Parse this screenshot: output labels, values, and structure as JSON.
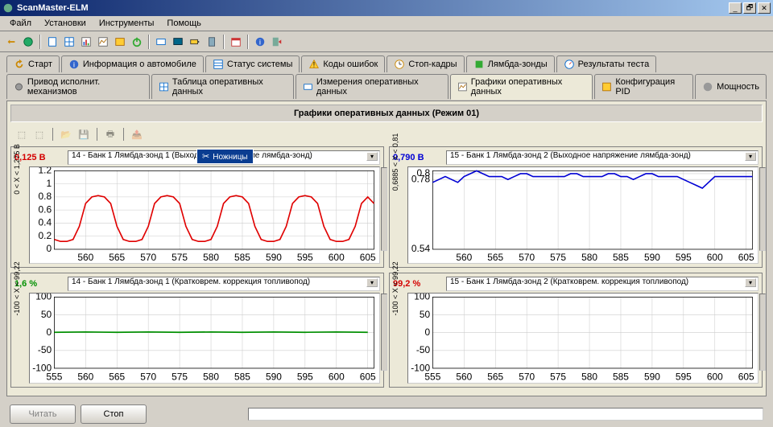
{
  "window": {
    "title": "ScanMaster-ELM"
  },
  "menu": [
    "Файл",
    "Установки",
    "Инструменты",
    "Помощь"
  ],
  "tabs1": [
    {
      "label": "Старт"
    },
    {
      "label": "Информация о автомобиле"
    },
    {
      "label": "Статус системы"
    },
    {
      "label": "Коды ошибок"
    },
    {
      "label": "Стоп-кадры"
    },
    {
      "label": "Лямбда-зонды"
    },
    {
      "label": "Результаты теста"
    }
  ],
  "tabs2": [
    {
      "label": "Привод исполнит. механизмов"
    },
    {
      "label": "Таблица оперативных данных"
    },
    {
      "label": "Измерения оперативных данных"
    },
    {
      "label": "Графики оперативных данных",
      "active": true
    },
    {
      "label": "Конфигурация PID"
    },
    {
      "label": "Мощность"
    }
  ],
  "section_title": "Графики оперативных данных (Режим 01)",
  "tooltip": {
    "text": "Ножницы"
  },
  "buttons": {
    "read": "Читать",
    "stop": "Стоп"
  },
  "chart_data": [
    {
      "id": "c1",
      "value": "0,125 В",
      "value_color": "#d40000",
      "selector": "14 - Банк 1 Лямбда-зонд 1 (Выходное напряжение лямбда-зонд)",
      "type": "line",
      "x": [
        555,
        556,
        557,
        558,
        559,
        560,
        561,
        562,
        563,
        564,
        565,
        566,
        567,
        568,
        569,
        570,
        571,
        572,
        573,
        574,
        575,
        576,
        577,
        578,
        579,
        580,
        581,
        582,
        583,
        584,
        585,
        586,
        587,
        588,
        589,
        590,
        591,
        592,
        593,
        594,
        595,
        596,
        597,
        598,
        599,
        600,
        601,
        602,
        603,
        604,
        605,
        606
      ],
      "y": [
        0.15,
        0.12,
        0.12,
        0.15,
        0.35,
        0.7,
        0.8,
        0.82,
        0.8,
        0.7,
        0.35,
        0.15,
        0.12,
        0.12,
        0.15,
        0.35,
        0.7,
        0.8,
        0.82,
        0.8,
        0.7,
        0.35,
        0.15,
        0.12,
        0.12,
        0.15,
        0.35,
        0.7,
        0.8,
        0.82,
        0.8,
        0.7,
        0.35,
        0.15,
        0.12,
        0.12,
        0.15,
        0.35,
        0.7,
        0.8,
        0.82,
        0.8,
        0.7,
        0.35,
        0.15,
        0.12,
        0.12,
        0.15,
        0.35,
        0.7,
        0.8,
        0.7
      ],
      "xlim": [
        555,
        606
      ],
      "ylim": [
        0,
        1.2
      ],
      "yticks": [
        0,
        0.2,
        0.4,
        0.6,
        0.8,
        1,
        1.2
      ],
      "xticks": [
        560,
        565,
        570,
        575,
        580,
        585,
        590,
        595,
        600,
        605
      ],
      "ylabel": "0 < X < 1,275 В",
      "line_color": "#e00000"
    },
    {
      "id": "c2",
      "value": "0,790 В",
      "value_color": "#0000d4",
      "selector": "15 - Банк 1 Лямбда-зонд 2 (Выходное напряжение лямбда-зонд)",
      "type": "line",
      "x": [
        555,
        556,
        557,
        558,
        559,
        560,
        561,
        562,
        563,
        564,
        565,
        566,
        567,
        568,
        569,
        570,
        571,
        572,
        573,
        574,
        575,
        576,
        577,
        578,
        579,
        580,
        581,
        582,
        583,
        584,
        585,
        586,
        587,
        588,
        589,
        590,
        591,
        592,
        593,
        594,
        595,
        596,
        597,
        598,
        599,
        600,
        601,
        602,
        603,
        604,
        605,
        606
      ],
      "y": [
        0.77,
        0.78,
        0.79,
        0.78,
        0.77,
        0.79,
        0.8,
        0.81,
        0.8,
        0.79,
        0.79,
        0.79,
        0.78,
        0.79,
        0.8,
        0.8,
        0.79,
        0.79,
        0.79,
        0.79,
        0.79,
        0.79,
        0.8,
        0.8,
        0.79,
        0.79,
        0.79,
        0.79,
        0.8,
        0.8,
        0.79,
        0.79,
        0.78,
        0.79,
        0.8,
        0.8,
        0.79,
        0.79,
        0.79,
        0.79,
        0.78,
        0.77,
        0.76,
        0.75,
        0.77,
        0.79,
        0.79,
        0.79,
        0.79,
        0.79,
        0.79,
        0.79
      ],
      "xlim": [
        555,
        606
      ],
      "ylim": [
        0.54,
        0.81
      ],
      "yticks": [
        0.54,
        0.78,
        0.8
      ],
      "xticks": [
        560,
        565,
        570,
        575,
        580,
        585,
        590,
        595,
        600,
        605
      ],
      "ylabel": "0,6885 < X < 0,81",
      "line_color": "#0000d4"
    },
    {
      "id": "c3",
      "value": "1,6 %",
      "value_color": "#009000",
      "selector": "14 - Банк 1 Лямбда-зонд 1 (Кратковрем. коррекция топливопод)",
      "type": "line",
      "x": [
        555,
        560,
        565,
        570,
        575,
        580,
        585,
        590,
        595,
        600,
        605
      ],
      "y": [
        1,
        2,
        1,
        2,
        1,
        2,
        1,
        2,
        1,
        2,
        1
      ],
      "xlim": [
        555,
        606
      ],
      "ylim": [
        -100,
        100
      ],
      "yticks": [
        -100,
        -50,
        0,
        50,
        100
      ],
      "xticks": [
        555,
        560,
        565,
        570,
        575,
        580,
        585,
        590,
        595,
        600,
        605
      ],
      "ylabel": "-100 < X < 99,22",
      "line_color": "#009000"
    },
    {
      "id": "c4",
      "value": "99,2 %",
      "value_color": "#d40000",
      "selector": "15 - Банк 1 Лямбда-зонд 2 (Кратковрем. коррекция топливопод)",
      "type": "line",
      "x": [],
      "y": [],
      "xlim": [
        555,
        606
      ],
      "ylim": [
        -100,
        100
      ],
      "yticks": [
        -100,
        -50,
        0,
        50,
        100
      ],
      "xticks": [
        555,
        560,
        565,
        570,
        575,
        580,
        585,
        590,
        595,
        600,
        605
      ],
      "ylabel": "-100 < X < 99,22",
      "line_color": "#d40000"
    }
  ]
}
